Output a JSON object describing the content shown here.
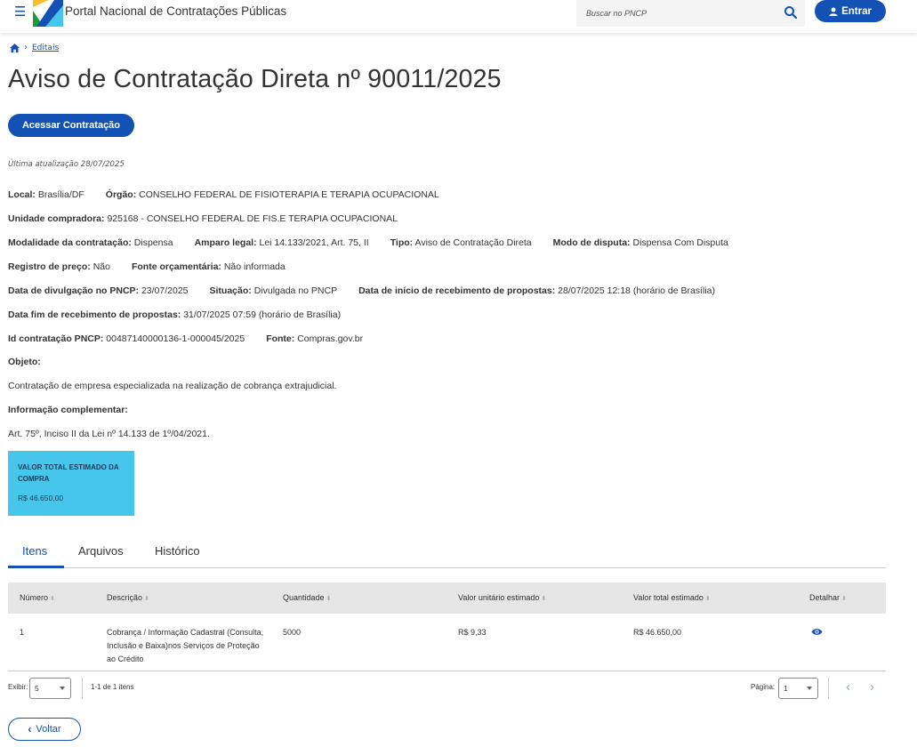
{
  "header": {
    "portal_title": "Portal Nacional de Contratações Públicas",
    "search_placeholder": "Buscar no PNCP",
    "login_label": "Entrar"
  },
  "breadcrumb": {
    "item": "Editais"
  },
  "page_title": "Aviso de Contratação Direta nº 90011/2025",
  "access_button": "Acessar Contratação",
  "last_update": "Última atualização 28/07/2025",
  "info": {
    "local_label": "Local:",
    "local": "Brasília/DF",
    "orgao_label": "Órgão:",
    "orgao": "CONSELHO FEDERAL DE FISIOTERAPIA E TERAPIA OCUPACIONAL",
    "unidade_label": "Unidade compradora:",
    "unidade": "925168 - CONSELHO FEDERAL DE FIS.E TERAPIA OCUPACIONAL",
    "modalidade_label": "Modalidade da contratação:",
    "modalidade": "Dispensa",
    "amparo_label": "Amparo legal:",
    "amparo": "Lei 14.133/2021, Art. 75, II",
    "tipo_label": "Tipo:",
    "tipo": "Aviso de Contratação Direta",
    "modo_label": "Modo de disputa:",
    "modo": "Dispensa Com Disputa",
    "registro_label": "Registro de preço:",
    "registro": "Não",
    "fonte_orc_label": "Fonte orçamentária:",
    "fonte_orc": "Não informada",
    "divulgacao_label": "Data de divulgação no PNCP:",
    "divulgacao": "23/07/2025",
    "situacao_label": "Situação:",
    "situacao": "Divulgada no PNCP",
    "inicio_label": "Data de início de recebimento de propostas:",
    "inicio": "28/07/2025 12:18 (horário de Brasília)",
    "fim_label": "Data fim de recebimento de propostas:",
    "fim": "31/07/2025 07:59 (horário de Brasília)",
    "id_label": "Id contratação PNCP:",
    "id": "00487140000136-1-000045/2025",
    "fonte_label": "Fonte:",
    "fonte": "Compras.gov.br",
    "objeto_label": "Objeto:",
    "objeto": "Contratação de empresa especializada na realização de cobrança extrajudicial.",
    "info_comp_label": "Informação complementar:",
    "info_comp": "Art. 75º, Inciso II da Lei nº 14.133 de 1º/04/2021."
  },
  "value_card": {
    "label": "VALOR TOTAL ESTIMADO DA COMPRA",
    "amount": "R$ 46.650,00",
    "color": "#45c6ea"
  },
  "tabs": [
    "Itens",
    "Arquivos",
    "Histórico"
  ],
  "table": {
    "headers": [
      "Número",
      "Descrição",
      "Quantidade",
      "Valor unitário estimado",
      "Valor total estimado",
      "Detalhar"
    ],
    "rows": [
      {
        "numero": "1",
        "descricao": "Cobrança / Informação Cadastral (Consulta, Inclusão e Baixa)nos Serviços de Proteção ao Crédito",
        "quantidade": "5000",
        "valor_unitario": "R$ 9,33",
        "valor_total": "R$ 46.650,00",
        "detalhar_icon": "eye-icon"
      }
    ]
  },
  "pagination": {
    "exibir_label": "Exibir:",
    "exibir_value": "5",
    "range": "1-1 de 1 itens",
    "pagina_label": "Página:",
    "pagina_value": "1"
  },
  "back_button": "Voltar",
  "colors": {
    "primary": "#1351b4",
    "card": "#45c6ea"
  }
}
